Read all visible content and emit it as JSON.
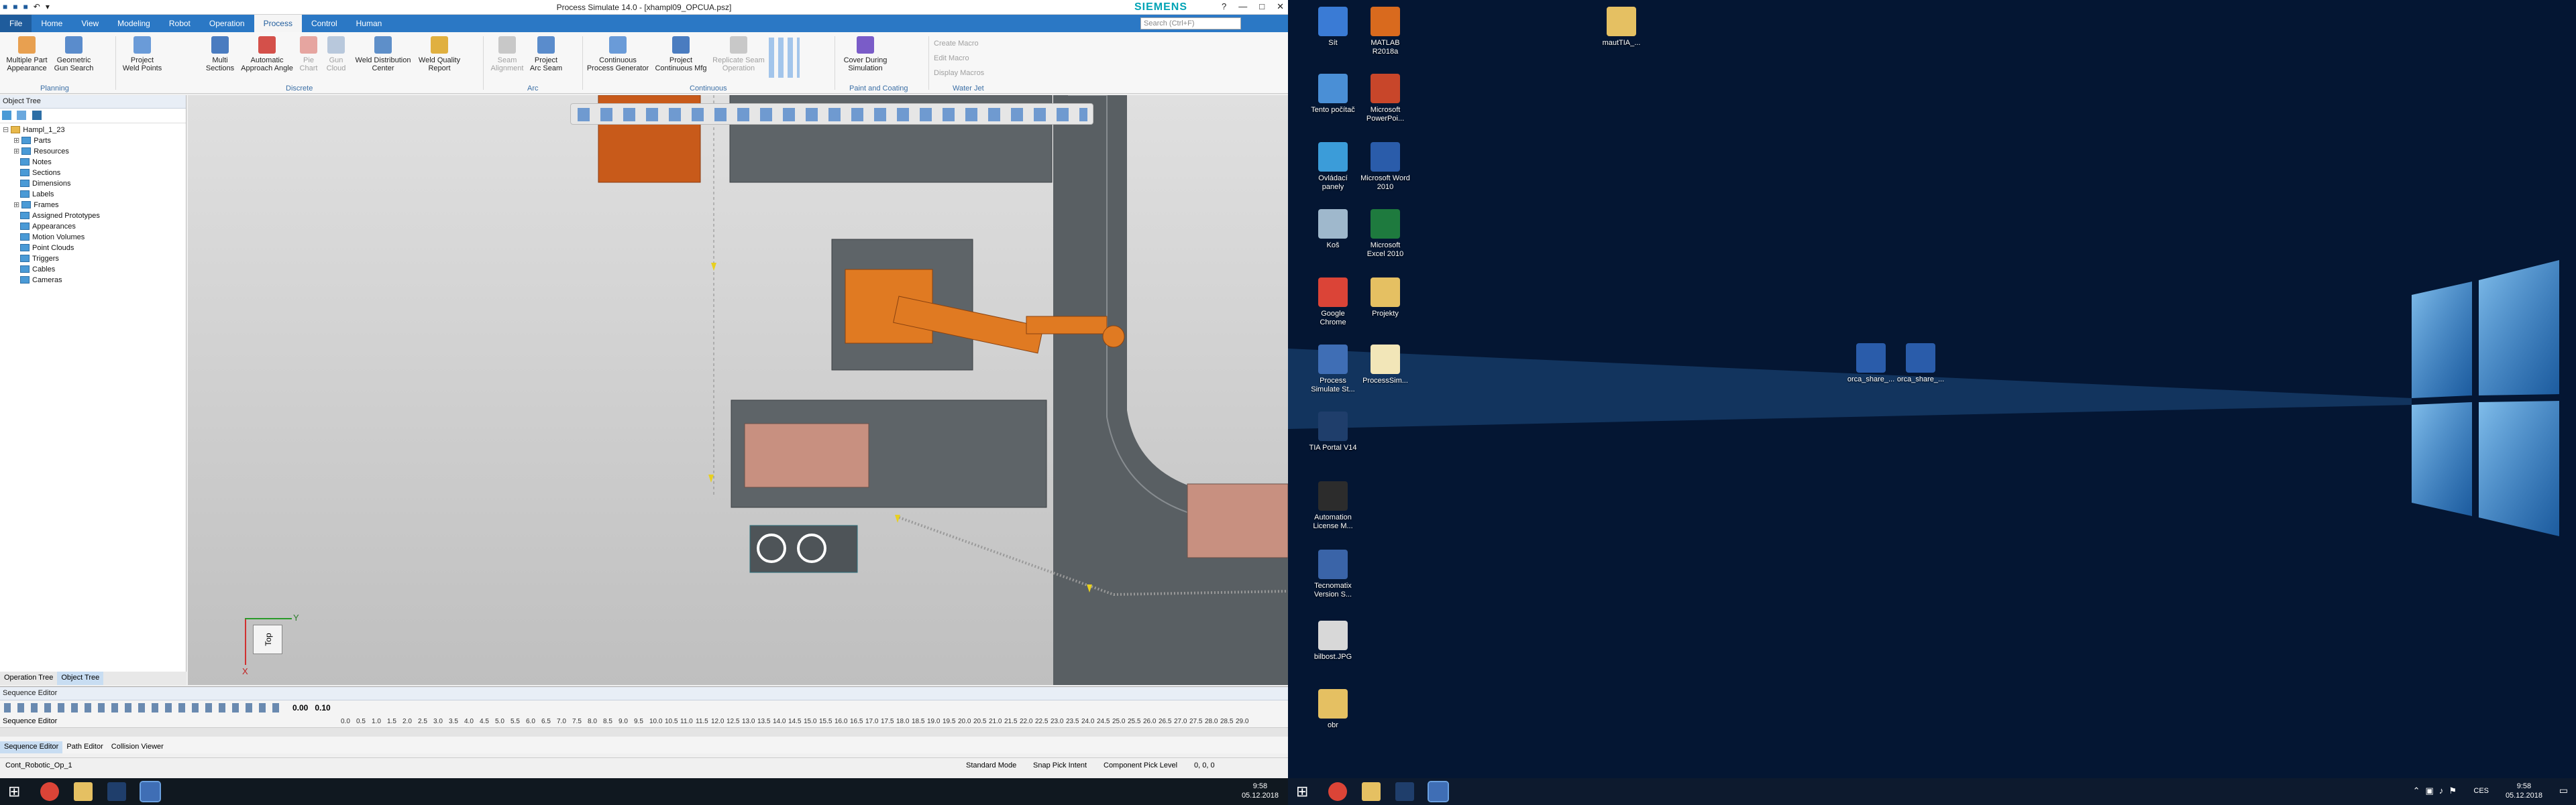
{
  "app": {
    "title": "Process Simulate 14.0 - [xhampl09_OPCUA.psz]",
    "brand": "SIEMENS",
    "search_placeholder": "Search (Ctrl+F)",
    "quick_access": [
      "■",
      "■",
      "■",
      "↶",
      "▾"
    ],
    "window_buttons": [
      "?",
      "—",
      "□",
      "✕"
    ]
  },
  "tabs": [
    "File",
    "Home",
    "View",
    "Modeling",
    "Robot",
    "Operation",
    "Process",
    "Control",
    "Human"
  ],
  "active_tab": "Process",
  "ribbon": {
    "buttons": [
      {
        "label": "Multiple Part\nAppearance",
        "dim": false
      },
      {
        "label": "Geometric\nGun Search",
        "dim": false
      },
      {
        "label": "Project\nWeld Points",
        "dim": false
      },
      {
        "label": "Multi\nSections",
        "dim": false
      },
      {
        "label": "Automatic\nApproach Angle",
        "dim": false
      },
      {
        "label": "Pie\nChart",
        "dim": true
      },
      {
        "label": "Gun\nCloud",
        "dim": true
      },
      {
        "label": "Weld Distribution\nCenter",
        "dim": false
      },
      {
        "label": "Weld Quality\nReport",
        "dim": false
      },
      {
        "label": "Seam\nAlignment",
        "dim": true
      },
      {
        "label": "Project\nArc Seam",
        "dim": false
      },
      {
        "label": "Continuous\nProcess Generator",
        "dim": false
      },
      {
        "label": "Project\nContinuous Mfg",
        "dim": false
      },
      {
        "label": "Replicate Seam\nOperation",
        "dim": true
      },
      {
        "label": "Cover During\nSimulation",
        "dim": false
      }
    ],
    "macro_items": [
      "Create Macro",
      "Edit Macro",
      "Display Macros"
    ],
    "groups": [
      "Planning",
      "Discrete",
      "Arc",
      "Continuous",
      "Paint and Coating",
      "Water Jet"
    ]
  },
  "object_tree": {
    "header": "Object Tree",
    "items": [
      {
        "label": "Hampl_1_23",
        "indent": 0
      },
      {
        "label": "Parts",
        "indent": 1
      },
      {
        "label": "Resources",
        "indent": 1
      },
      {
        "label": "Notes",
        "indent": 1
      },
      {
        "label": "Sections",
        "indent": 1
      },
      {
        "label": "Dimensions",
        "indent": 1
      },
      {
        "label": "Labels",
        "indent": 1
      },
      {
        "label": "Frames",
        "indent": 1
      },
      {
        "label": "Assigned Prototypes",
        "indent": 1
      },
      {
        "label": "Appearances",
        "indent": 1
      },
      {
        "label": "Motion Volumes",
        "indent": 1
      },
      {
        "label": "Point Clouds",
        "indent": 1
      },
      {
        "label": "Triggers",
        "indent": 1
      },
      {
        "label": "Cables",
        "indent": 1
      },
      {
        "label": "Cameras",
        "indent": 1
      }
    ],
    "bottom_tabs": [
      "Operation Tree",
      "Object Tree"
    ]
  },
  "viewport": {
    "axis_y": "Y",
    "axis_x": "X",
    "cube_label": "Top"
  },
  "sequence_editor": {
    "header": "Sequence Editor",
    "row_label": "Sequence Editor",
    "time_value": "0.00",
    "step_value": "0.10",
    "ruler": [
      "0.0",
      "0.5",
      "1.0",
      "1.5",
      "2.0",
      "2.5",
      "3.0",
      "3.5",
      "4.0",
      "4.5",
      "5.0",
      "5.5",
      "6.0",
      "6.5",
      "7.0",
      "7.5",
      "8.0",
      "8.5",
      "9.0",
      "9.5",
      "10.0",
      "10.5",
      "11.0",
      "11.5",
      "12.0",
      "12.5",
      "13.0",
      "13.5",
      "14.0",
      "14.5",
      "15.0",
      "15.5",
      "16.0",
      "16.5",
      "17.0",
      "17.5",
      "18.0",
      "18.5",
      "19.0",
      "19.5",
      "20.0",
      "20.5",
      "21.0",
      "21.5",
      "22.0",
      "22.5",
      "23.0",
      "23.5",
      "24.0",
      "24.5",
      "25.0",
      "25.5",
      "26.0",
      "26.5",
      "27.0",
      "27.5",
      "28.0",
      "28.5",
      "29.0"
    ],
    "tabs": [
      "Sequence Editor",
      "Path Editor",
      "Collision Viewer"
    ]
  },
  "statusbar": {
    "left": "Cont_Robotic_Op_1",
    "mode": "Standard Mode",
    "pick_intent": "Snap Pick Intent",
    "pick_level": "Component Pick Level",
    "coords": "0, 0, 0"
  },
  "taskbar_left": {
    "time": "9:58",
    "date": "05.12.2018"
  },
  "taskbar_right": {
    "time": "9:58",
    "date": "05.12.2018",
    "lang": "CES"
  },
  "desktop_icons": [
    {
      "label": "Sít",
      "color": "#3a7bd5"
    },
    {
      "label": "MATLAB R2018a",
      "color": "#d96a1e"
    },
    {
      "label": "Tento počítač",
      "color": "#4a8fd6"
    },
    {
      "label": "Microsoft PowerPoi...",
      "color": "#c8462a"
    },
    {
      "label": "Ovládací panely",
      "color": "#3b9cd9"
    },
    {
      "label": "Microsoft Word 2010",
      "color": "#2a5caa"
    },
    {
      "label": "Koš",
      "color": "#9fb8cc"
    },
    {
      "label": "Microsoft Excel 2010",
      "color": "#1e7a3e"
    },
    {
      "label": "Google Chrome",
      "color": "#db4437"
    },
    {
      "label": "Projekty",
      "color": "#e5c062"
    },
    {
      "label": "Process Simulate St...",
      "color": "#3f6eb5"
    },
    {
      "label": "ProcessSim...",
      "color": "#f2e6b8"
    },
    {
      "label": "TIA Portal V14",
      "color": "#1f3e6b"
    },
    {
      "label": "Automation License M...",
      "color": "#2c2c2c"
    },
    {
      "label": "Tecnomatix Version S...",
      "color": "#3a64a8"
    },
    {
      "label": "bilbost.JPG",
      "color": "#d8d8d8"
    },
    {
      "label": "obr",
      "color": "#e5c062"
    },
    {
      "label": "mautTIA_...",
      "color": "#e5c062"
    },
    {
      "label": "orca_share_...",
      "color": "#2a5caa"
    },
    {
      "label": "orca_share_...",
      "color": "#2a5caa"
    }
  ]
}
